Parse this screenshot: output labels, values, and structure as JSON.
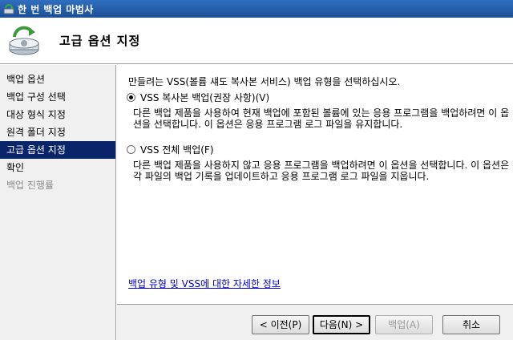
{
  "window": {
    "title": "한 번 백업 마법사"
  },
  "header": {
    "page_title": "고급 옵션 지정"
  },
  "sidebar": {
    "items": [
      {
        "label": "백업 옵션",
        "state": "normal"
      },
      {
        "label": "백업 구성 선택",
        "state": "normal"
      },
      {
        "label": "대상 형식 지정",
        "state": "normal"
      },
      {
        "label": "원격 폴더 지정",
        "state": "normal"
      },
      {
        "label": "고급 옵션 지정",
        "state": "active"
      },
      {
        "label": "확인",
        "state": "normal"
      },
      {
        "label": "백업 진행률",
        "state": "disabled"
      }
    ]
  },
  "main": {
    "instruction": "만들려는 VSS(볼륨 섀도 복사본 서비스) 백업 유형을 선택하십시오.",
    "options": [
      {
        "label": "VSS 복사본 백업(권장 사항)(V)",
        "checked": true,
        "description": "다른 백업 제품을 사용하여 현재 백업에 포함된 볼륨에 있는 응용 프로그램을 백업하려면 이 옵션을 선택합니다. 이 옵션은 응용 프로그램 로그 파일을 유지합니다."
      },
      {
        "label": "VSS 전체 백업(F)",
        "checked": false,
        "description": "다른 백업 제품을 사용하지 않고 응용 프로그램을 백업하려면 이 옵션을 선택합니다. 이 옵션은 각 파일의 백업 기록을 업데이트하고 응용 프로그램 로그 파일을 지웁니다."
      }
    ],
    "more_info_link": "백업 유형 및 VSS에 대한 자세한 정보"
  },
  "footer": {
    "back": "< 이전(P)",
    "next": "다음(N) >",
    "backup": "백업(A)",
    "cancel": "취소"
  },
  "colors": {
    "selection": "#0a246a",
    "title_bar": "#2f6fbf",
    "link": "#0000cc"
  }
}
